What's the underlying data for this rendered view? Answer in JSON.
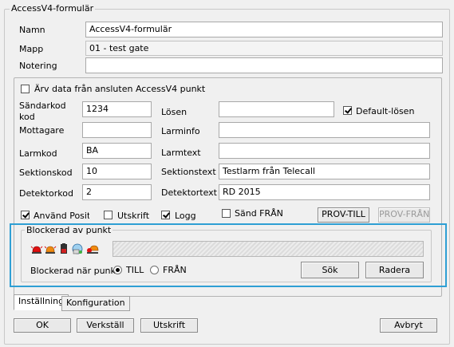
{
  "form": {
    "title": "AccessV4-formulär",
    "fields": {
      "namn": {
        "label": "Namn",
        "value": "AccessV4-formulär"
      },
      "mapp": {
        "label": "Mapp",
        "value": "01 - test gate"
      },
      "notering": {
        "label": "Notering",
        "value": ""
      }
    }
  },
  "panel": {
    "inherit_label": "Ärv data från ansluten AccessV4 punkt",
    "inherit_checked": false,
    "left": {
      "sandarkod": {
        "label": "Sändarkod kod",
        "value": "1234"
      },
      "mottagare": {
        "label": "Mottagare",
        "value": ""
      },
      "larmkod": {
        "label": "Larmkod",
        "value": "BA"
      },
      "sektionskod": {
        "label": "Sektionskod",
        "value": "10"
      },
      "detektorkod": {
        "label": "Detektorkod",
        "value": "2"
      }
    },
    "right": {
      "losen": {
        "label": "Lösen",
        "value": ""
      },
      "larminfo": {
        "label": "Larminfo",
        "value": ""
      },
      "larmtext": {
        "label": "Larmtext",
        "value": ""
      },
      "sektionstext": {
        "label": "Sektionstext",
        "value": "Testlarm från Telecall"
      },
      "detektortext": {
        "label": "Detektortext",
        "value": "RD 2015"
      }
    },
    "default_losen": {
      "label": "Default-lösen",
      "checked": true
    },
    "options": {
      "anvand": {
        "label": "Använd Positic",
        "checked": true
      },
      "utskrift": {
        "label": "Utskrift",
        "checked": false
      },
      "logg": {
        "label": "Logg",
        "checked": true
      },
      "sand_fran": {
        "label": "Sänd FRÅN",
        "checked": false
      }
    },
    "prov_till": "PROV-TILL",
    "prov_fran": "PROV-FRÅN"
  },
  "blocked": {
    "title": "Blockerad av punkt",
    "when_label": "Blockerad när punkt",
    "till_label": "TILL",
    "fran_label": "FRÅN",
    "selected": "TILL",
    "sok": "Sök",
    "radera": "Radera",
    "icons": [
      "red-siren-icon",
      "orange-siren-icon",
      "battery-alarm-icon",
      "network-icon",
      "alarm-person-icon"
    ]
  },
  "tabs": [
    "Inställning",
    "Konfiguration"
  ],
  "buttons": {
    "ok": "OK",
    "verkstall": "Verkställ",
    "utskrift": "Utskrift",
    "avbryt": "Avbryt"
  },
  "colors": {
    "highlight": "#2e9fd4"
  }
}
